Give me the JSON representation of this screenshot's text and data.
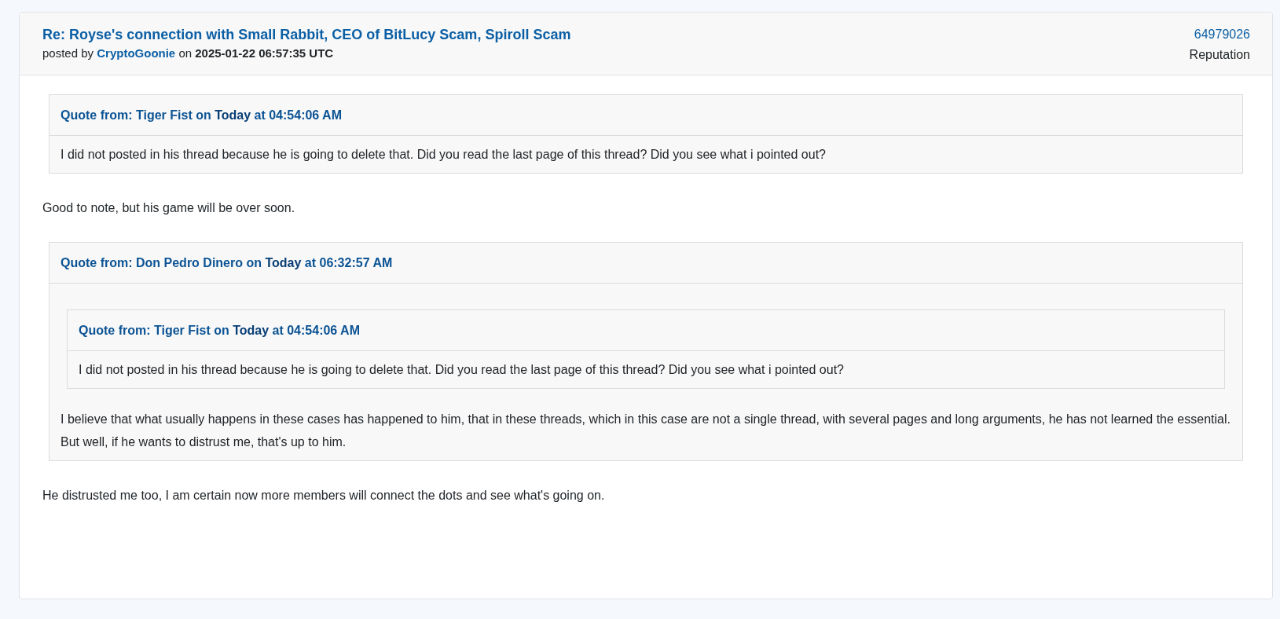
{
  "post": {
    "title": "Re: Royse's connection with Small Rabbit, CEO of BitLucy Scam, Spiroll Scam",
    "byline": {
      "before": "posted by",
      "author": "CryptoGoonie",
      "middle": "on",
      "date": "2025-01-22 06:57:35 UTC"
    },
    "post_id": "64979026",
    "reputation_label": "Reputation",
    "body": [
      {
        "kind": "quote",
        "header": "Quote from: Tiger Fist on **Today** at 04:54:06 AM",
        "body": [
          {
            "kind": "paragraph",
            "text": "I did not posted in his thread because he is going to delete that. Did you read the last page of this thread? Did you see what i pointed out?"
          }
        ]
      },
      {
        "kind": "paragraph",
        "text": "Good to note, but his game will be over soon."
      },
      {
        "kind": "quote",
        "header": "Quote from: Don Pedro Dinero on **Today** at 06:32:57 AM",
        "body": [
          {
            "kind": "quote",
            "header": "Quote from: Tiger Fist on **Today** at 04:54:06 AM",
            "body": [
              {
                "kind": "paragraph",
                "text": "I did not posted in his thread because he is going to delete that. Did you read the last page of this thread? Did you see what i pointed out?"
              }
            ]
          },
          {
            "kind": "paragraph",
            "text": "I believe that what usually happens in these cases has happened to him, that in these threads, which in this case are not a single thread, with several pages and long arguments, he has not learned the essential. But well, if he wants to distrust me, that's up to him."
          }
        ]
      },
      {
        "kind": "paragraph",
        "text": "He distrusted me too, I am certain now more members will connect the dots and see what's going on."
      }
    ]
  }
}
